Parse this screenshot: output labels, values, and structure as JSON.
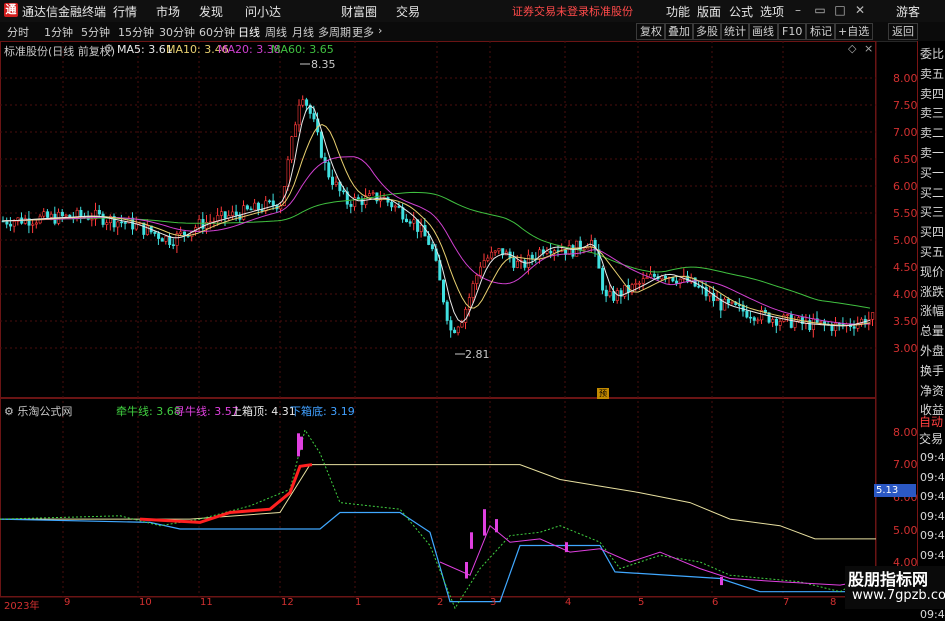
{
  "window": {
    "logo": "通",
    "title": "通达信金融终端",
    "menu": [
      "行情",
      "市场",
      "发现",
      "问小达",
      "财富圈",
      "交易"
    ],
    "login_warning": "证券交易未登录",
    "stock_name_top": "标准股份",
    "right_menu": [
      "功能",
      "版面",
      "公式",
      "选项"
    ],
    "guest": "游客"
  },
  "toolbar": {
    "periods": [
      "分时",
      "1分钟",
      "5分钟",
      "15分钟",
      "30分钟",
      "60分钟",
      "日线",
      "周线",
      "月线",
      "多周期",
      "更多"
    ],
    "active_period": "日线",
    "right_buttons": [
      "复权",
      "叠加",
      "多股",
      "统计",
      "画线",
      "F10",
      "标记",
      "+自选",
      "返回"
    ]
  },
  "main_chart": {
    "title": "标准股份(日线 前复权)",
    "ma": [
      {
        "label": "MA5: 3.61",
        "color": "#e8e8e8"
      },
      {
        "label": "MA10: 3.46",
        "color": "#e8d070"
      },
      {
        "label": "MA20: 3.38",
        "color": "#d040d0"
      },
      {
        "label": "MA60: 3.65",
        "color": "#40c040"
      }
    ],
    "high_label": "8.35",
    "low_label": "2.81",
    "tag": "预"
  },
  "sub_chart": {
    "title": "乐淘公式网",
    "indicators": [
      {
        "label": "牵牛线: 3.68",
        "color": "#40d040"
      },
      {
        "label": "寻牛线: 3.57",
        "color": "#e040e0"
      },
      {
        "label": "上箱顶: 4.31",
        "color": "#e8e8e8"
      },
      {
        "label": "下箱底: 3.19",
        "color": "#40a0ff"
      }
    ],
    "current_price": "5.13"
  },
  "price_axis": [
    "8.00",
    "7.50",
    "7.00",
    "6.50",
    "6.00",
    "5.50",
    "5.00",
    "4.50",
    "4.00",
    "3.50",
    "3.00"
  ],
  "sub_axis": [
    "8.00",
    "7.00",
    "6.00",
    "5.00",
    "4.00"
  ],
  "x_axis": [
    "2023年",
    "9",
    "10",
    "11",
    "12",
    "1",
    "2",
    "3",
    "4",
    "5",
    "6",
    "7",
    "8"
  ],
  "sidebar": [
    "委比",
    "卖五",
    "卖四",
    "卖三",
    "卖二",
    "卖一",
    "买一",
    "买二",
    "买三",
    "买四",
    "买五",
    "现价",
    "涨跌",
    "涨幅",
    "总量",
    "外盘",
    "换手",
    "净资",
    "收益"
  ],
  "sidebar_bottom": {
    "auto": "自动",
    "trade": "交易",
    "times": [
      "09:45",
      "09:45",
      "09:45",
      "09:46",
      "09:46",
      "09:46",
      "09:46",
      "09:47",
      "09:48"
    ]
  },
  "watermark": {
    "line1": "股朋指标网",
    "line2": "www.7gpzb.com"
  },
  "colors": {
    "up": "#ff3a3a",
    "down": "#40e0e0",
    "axis": "#d23030",
    "grid": "#5a1010"
  }
}
